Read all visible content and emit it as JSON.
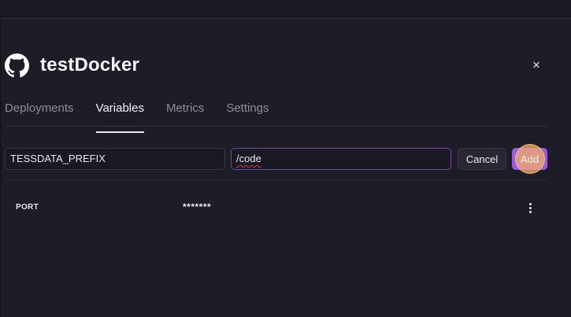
{
  "project": {
    "title": "testDocker",
    "logo_icon": "github-icon"
  },
  "close_label": "×",
  "tabs": [
    {
      "label": "Deployments",
      "active": false
    },
    {
      "label": "Variables",
      "active": true
    },
    {
      "label": "Metrics",
      "active": false
    },
    {
      "label": "Settings",
      "active": false
    }
  ],
  "new_variable": {
    "key_value": "TESSDATA_PREFIX",
    "value_value": "/code",
    "cancel_label": "Cancel",
    "add_label": "Add"
  },
  "variables": [
    {
      "name": "PORT",
      "value": "*******"
    }
  ],
  "colors": {
    "background": "#1e1c27",
    "accent": "#9a5be0",
    "focus_border": "#6b4ba3"
  }
}
